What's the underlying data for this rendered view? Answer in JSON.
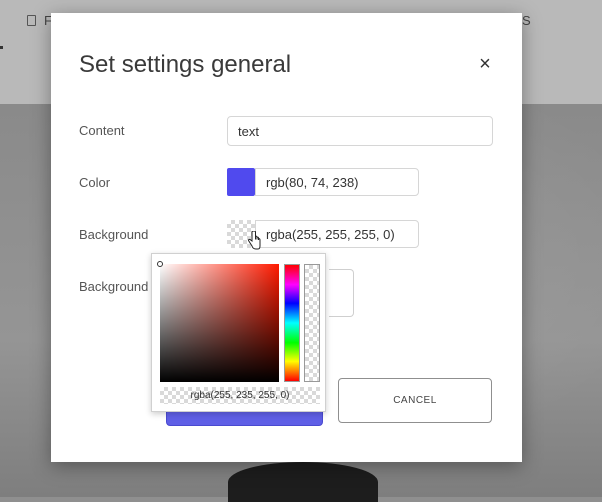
{
  "background_app": {
    "header_left_letter": "F",
    "header_right_letter": "S"
  },
  "modal": {
    "title": "Set settings general",
    "close_icon": "close-icon",
    "rows": {
      "content": {
        "label": "Content",
        "value": "text"
      },
      "color": {
        "label": "Color",
        "swatch": "#504aee",
        "value": "rgb(80, 74, 238)"
      },
      "background": {
        "label": "Background",
        "swatch": "transparent",
        "value": "rgba(255, 255, 255, 0)"
      },
      "background_image": {
        "label": "Background I"
      }
    },
    "color_picker": {
      "value": "rgba(255, 235, 255, 0)",
      "hue_color": "#ff1a00"
    },
    "buttons": {
      "primary_color": "#5f5fe6",
      "cancel_label": "CANCEL"
    }
  }
}
